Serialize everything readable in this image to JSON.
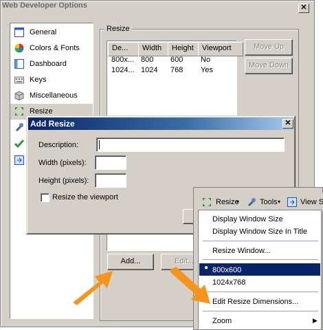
{
  "window": {
    "title": "Web Developer Options",
    "close": "✕"
  },
  "sidebar": {
    "items": [
      {
        "label": "General"
      },
      {
        "label": "Colors & Fonts"
      },
      {
        "label": "Dashboard"
      },
      {
        "label": "Keys"
      },
      {
        "label": "Miscellaneous"
      },
      {
        "label": "Resize"
      }
    ]
  },
  "group": {
    "label": "Resize"
  },
  "list": {
    "headers": [
      "De...",
      "Width",
      "Height",
      "Viewport"
    ],
    "rows": [
      [
        "800x...",
        "800",
        "600",
        "No"
      ],
      [
        "1024...",
        "1024",
        "768",
        "Yes"
      ]
    ]
  },
  "buttons": {
    "move_up": "Move Up",
    "move_down": "Move Down",
    "add": "Add...",
    "edit": "Edit..."
  },
  "dialog": {
    "title": "Add Resize",
    "close": "✕",
    "description_label": "Description:",
    "width_label": "Width (pixels):",
    "height_label": "Height (pixels):",
    "viewport_label": "Resize the viewport"
  },
  "toolbar": {
    "resize": "Resize",
    "tools": "Tools",
    "view": "View S"
  },
  "menu": {
    "display_window_size": "Display Window Size",
    "display_window_size_title": "Display Window Size In Title",
    "resize_window": "Resize Window...",
    "opt1": "800x600",
    "opt2": "1024x768",
    "edit_dimensions": "Edit Resize Dimensions...",
    "zoom": "Zoom"
  },
  "colors": {
    "accent": "#0a246a",
    "arrow": "#f7941d",
    "chrome": "#d4d0c8"
  }
}
